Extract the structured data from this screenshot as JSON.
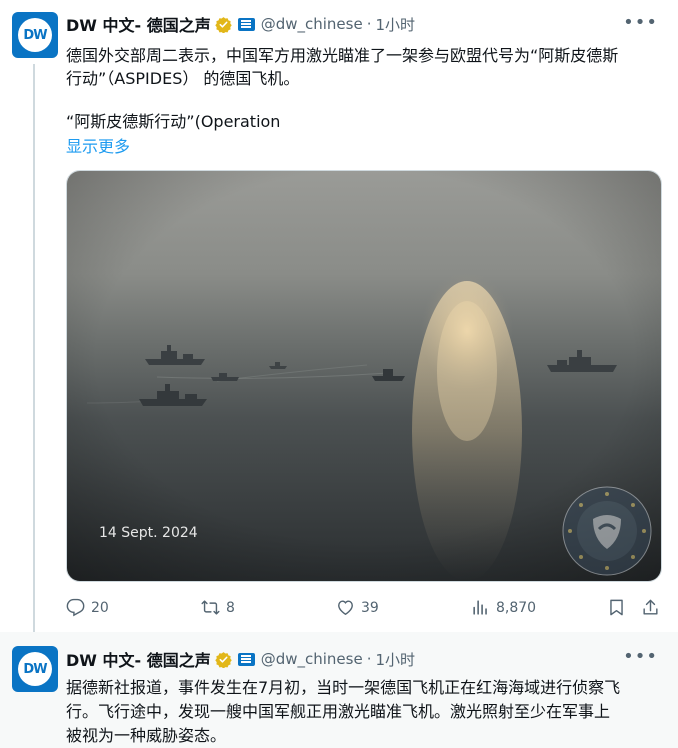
{
  "tweet1": {
    "avatar_text": "DW",
    "author_name": "DW 中文- 德国之声",
    "handle": "@dw_chinese",
    "separator": "·",
    "time": "1小时",
    "more_icon": "ellipsis-icon",
    "text_line1": "德国外交部周二表示，中国军方用激光瞄准了一架参与欧盟代号为“阿斯皮德斯",
    "text_line2": "行动”（ASPIDES） 的德国飞机。",
    "text_line3": "“阿斯皮德斯行动”(Operation",
    "show_more": "显示更多",
    "media": {
      "caption": "14 Sept. 2024",
      "description_icon": "aspides-emblem"
    },
    "actions": {
      "replies": "20",
      "reposts": "8",
      "likes": "39",
      "views": "8,870"
    }
  },
  "tweet2": {
    "avatar_text": "DW",
    "author_name": "DW 中文- 德国之声",
    "handle": "@dw_chinese",
    "separator": "·",
    "time": "1小时",
    "text_line1": "据德新社报道，事件发生在7月初，当时一架德国飞机正在红海海域进行侦察飞",
    "text_line2": "行。飞行途中，发现一艘中国军舰正用激光瞄准飞机。激光照射至少在军事上",
    "text_line3": "被视为一种威胁姿态。"
  },
  "colors": {
    "dw_blue": "#0a74c4",
    "link_blue": "#1d9bf0",
    "secondary_text": "#536471",
    "verified_gold": "#e2b719"
  }
}
